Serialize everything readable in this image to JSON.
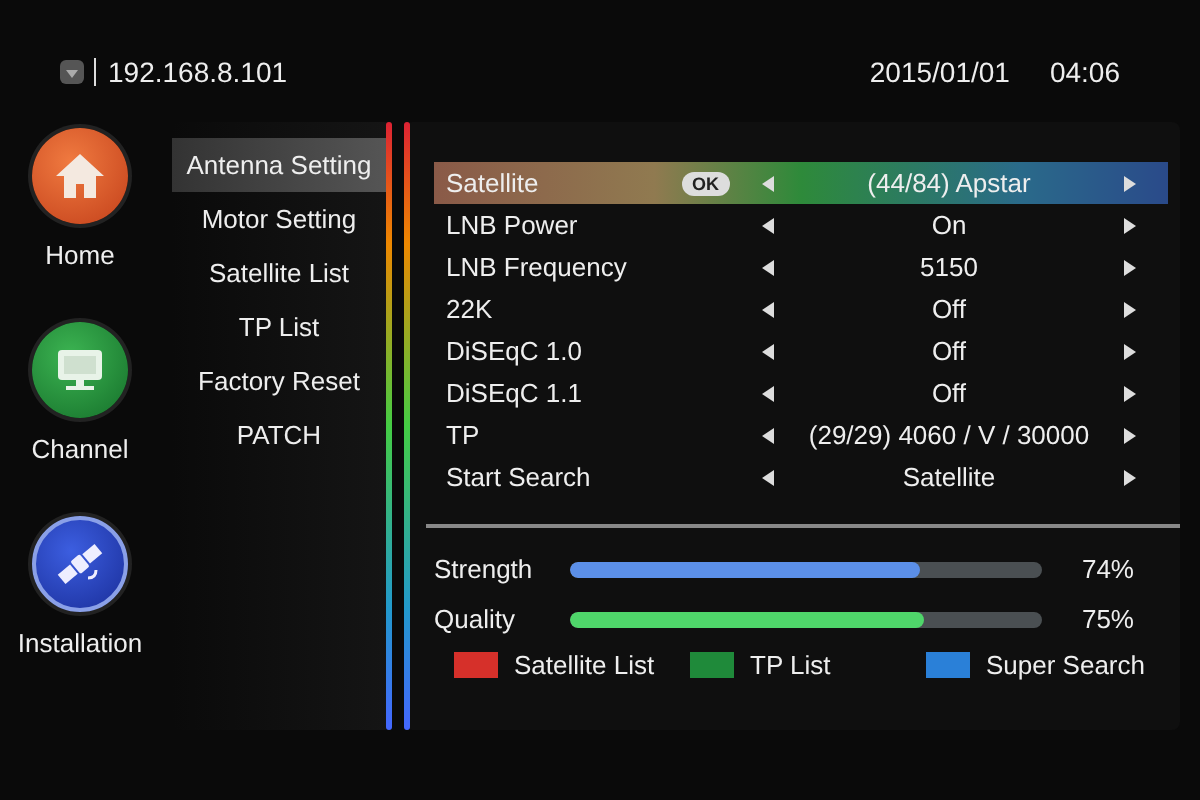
{
  "header": {
    "ip": "192.168.8.101",
    "date": "2015/01/01",
    "time": "04:06"
  },
  "main_menu": [
    {
      "label": "Home",
      "kind": "home"
    },
    {
      "label": "Channel",
      "kind": "channel"
    },
    {
      "label": "Installation",
      "kind": "installation"
    }
  ],
  "submenu": [
    {
      "label": "Antenna Setting",
      "selected": true
    },
    {
      "label": "Motor Setting",
      "selected": false
    },
    {
      "label": "Satellite List",
      "selected": false
    },
    {
      "label": "TP List",
      "selected": false
    },
    {
      "label": "Factory Reset",
      "selected": false
    },
    {
      "label": "PATCH",
      "selected": false
    }
  ],
  "settings": [
    {
      "label": "Satellite",
      "value": "(44/84) Apstar",
      "selected": true,
      "badge": "OK"
    },
    {
      "label": "LNB Power",
      "value": "On",
      "selected": false
    },
    {
      "label": "LNB Frequency",
      "value": "5150",
      "selected": false
    },
    {
      "label": "22K",
      "value": "Off",
      "selected": false
    },
    {
      "label": "DiSEqC 1.0",
      "value": "Off",
      "selected": false
    },
    {
      "label": "DiSEqC 1.1",
      "value": "Off",
      "selected": false
    },
    {
      "label": "TP",
      "value": "(29/29) 4060 / V / 30000",
      "selected": false
    },
    {
      "label": "Start Search",
      "value": "Satellite",
      "selected": false
    }
  ],
  "signal": [
    {
      "label": "Strength",
      "level": 0.74,
      "reading": "74%",
      "color": "#5b8fe8"
    },
    {
      "label": "Quality",
      "level": 0.75,
      "reading": "75%",
      "color": "#4fd66a"
    }
  ],
  "color_keys": [
    {
      "label": "Satellite List",
      "color": "#d6302a"
    },
    {
      "label": "TP List",
      "color": "#1f8a3a"
    },
    {
      "label": "Super Search",
      "color": "#2a80d8"
    }
  ]
}
